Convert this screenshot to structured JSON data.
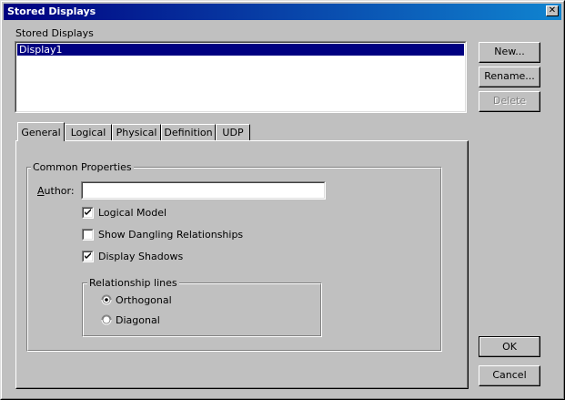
{
  "window": {
    "title": "Stored Displays",
    "close_glyph": "✕"
  },
  "stored_displays": {
    "label": "Stored Displays",
    "items": [
      "Display1"
    ]
  },
  "buttons": {
    "new": "New...",
    "rename": "Rename...",
    "delete": "Delete",
    "ok": "OK",
    "cancel": "Cancel"
  },
  "tabs": [
    {
      "label": "General",
      "active": true
    },
    {
      "label": "Logical",
      "active": false
    },
    {
      "label": "Physical",
      "active": false
    },
    {
      "label": "Definition",
      "active": false
    },
    {
      "label": "UDP",
      "active": false
    }
  ],
  "common_properties": {
    "label": "Common Properties",
    "author_label": "Author:",
    "author_value": "",
    "checkboxes": [
      {
        "label": "Logical Model",
        "checked": true
      },
      {
        "label": "Show Dangling Relationships",
        "checked": false
      },
      {
        "label": "Display Shadows",
        "checked": true
      }
    ]
  },
  "relationship_lines": {
    "label": "Relationship lines",
    "options": [
      {
        "label": "Orthogonal",
        "selected": true
      },
      {
        "label": "Diagonal",
        "selected": false
      }
    ]
  },
  "icons": {
    "close": "close-icon",
    "check": "checkmark-icon",
    "radio": "radio-icon"
  }
}
